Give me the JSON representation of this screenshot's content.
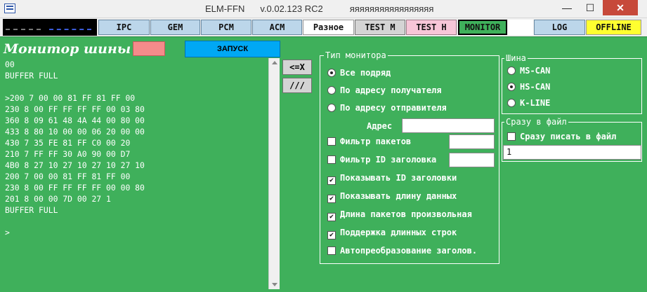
{
  "window": {
    "title_app": "ELM-FFN",
    "title_version": "v.0.02.123 RC2",
    "title_extra": "яяяяяяяяяяяяяяяяя",
    "minimize_glyph": "—",
    "maximize_glyph": "☐",
    "close_glyph": "✕"
  },
  "tabs": [
    {
      "label": "IPC"
    },
    {
      "label": "GEM"
    },
    {
      "label": "PCM"
    },
    {
      "label": "ACM"
    },
    {
      "label": "Разное"
    },
    {
      "label": "TEST M"
    },
    {
      "label": "TEST H"
    },
    {
      "label": "MONITOR"
    },
    {
      "label": ""
    },
    {
      "label": "LOG"
    },
    {
      "label": "OFFLINE"
    }
  ],
  "monitor": {
    "title": "Монитор шины",
    "start_label": "ЗАПУСК",
    "clear_label": "<=X",
    "slash_label": "///",
    "log_lines": [
      "00",
      "BUFFER FULL",
      "",
      ">200 7 00 00 81 FF 81 FF 00",
      "230 8 00 FF FF FF FF 00 03 80",
      "360 8 09 61 48 4A 44 00 80 00",
      "433 8 80 10 00 00 06 20 00 00",
      "430 7 35 FE 81 FF C0 00 20",
      "210 7 FF FF 30 A0 90 00 D7",
      "4B0 8 27 10 27 10 27 10 27 10",
      "200 7 00 00 81 FF 81 FF 00",
      "230 8 00 FF FF FF FF 00 00 80",
      "201 8 00 00 7D 00 27 1",
      "BUFFER FULL",
      "",
      ">"
    ]
  },
  "monitor_type": {
    "group_label": "Тип монитора",
    "radios": [
      {
        "label": "Все подряд",
        "checked": true
      },
      {
        "label": "По адресу получателя",
        "checked": false
      },
      {
        "label": "По адресу отправителя",
        "checked": false
      }
    ],
    "address_label": "Адрес",
    "address_value": "",
    "checkboxes": [
      {
        "label": "Фильтр пакетов",
        "checked": false
      },
      {
        "label": "Фильтр ID заголовка",
        "checked": false
      },
      {
        "label": "Показывать ID заголовки",
        "checked": true
      },
      {
        "label": "Показывать длину данных",
        "checked": true
      },
      {
        "label": "Длина пакетов произвольная",
        "checked": true
      },
      {
        "label": "Поддержка длинных строк",
        "checked": true
      },
      {
        "label": "Автопреобразование заголов.",
        "checked": false
      }
    ],
    "packet_filter_value": "",
    "id_filter_value": ""
  },
  "bus": {
    "group_label": "Шина",
    "radios": [
      {
        "label": "MS-CAN",
        "checked": false
      },
      {
        "label": "HS-CAN",
        "checked": true
      },
      {
        "label": "K-LINE",
        "checked": false
      }
    ]
  },
  "file": {
    "group_label": "Сразу в файл",
    "checkbox_label": "Сразу писать в файл",
    "checkbox_checked": false,
    "file_value": "1"
  }
}
